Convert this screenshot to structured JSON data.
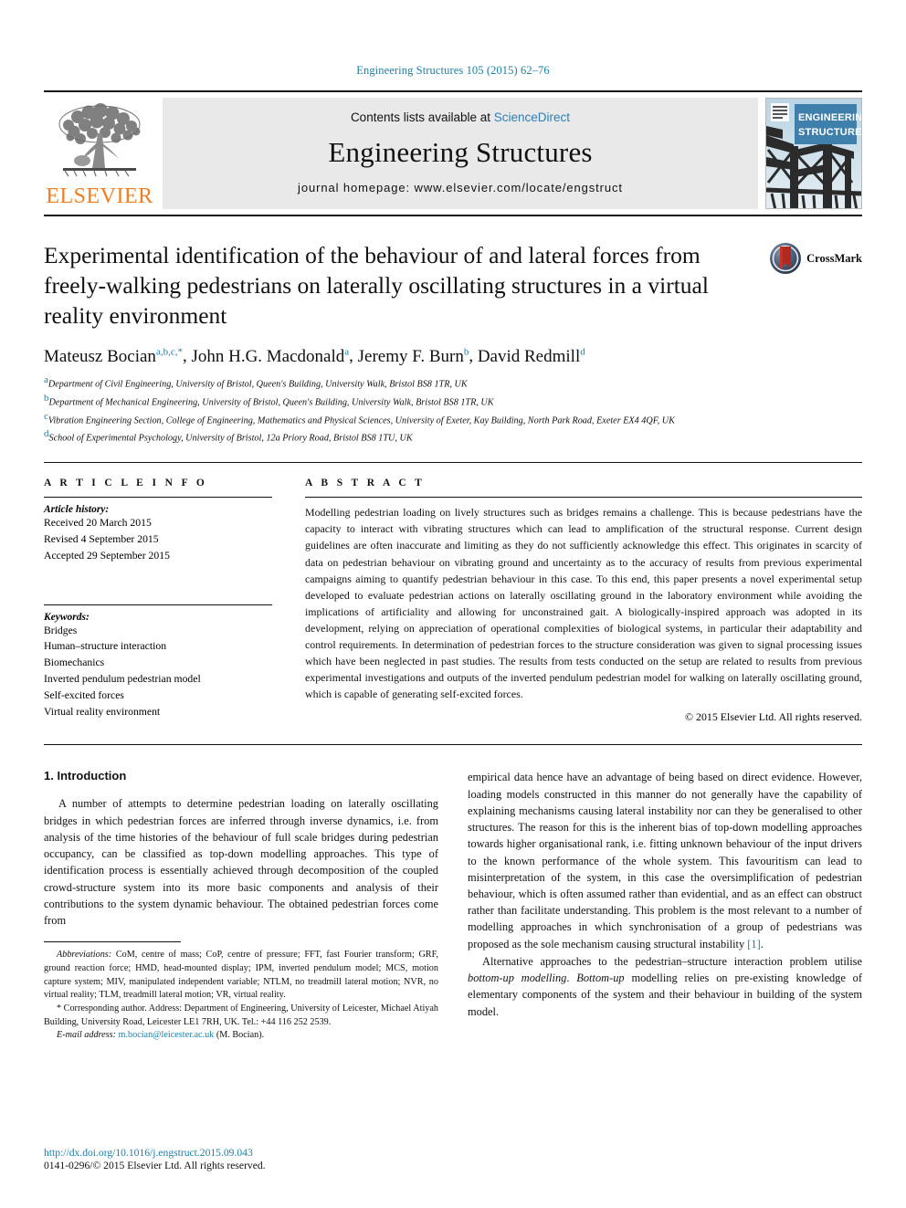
{
  "running_head": "Engineering Structures 105 (2015) 62–76",
  "masthead": {
    "publisher_wordmark": "ELSEVIER",
    "contents_prefix": "Contents lists available at ",
    "sciencedirect": "ScienceDirect",
    "journal_name": "Engineering Structures",
    "homepage": "journal homepage: www.elsevier.com/locate/engstruct",
    "cover_title_line1": "ENGINEERING",
    "cover_title_line2": "STRUCTURES"
  },
  "title": "Experimental identification of the behaviour of and lateral forces from freely-walking pedestrians on laterally oscillating structures in a virtual reality environment",
  "crossmark_label": "CrossMark",
  "authors": [
    {
      "name": "Mateusz Bocian",
      "marks": "a,b,c,*"
    },
    {
      "name": "John H.G. Macdonald",
      "marks": "a"
    },
    {
      "name": "Jeremy F. Burn",
      "marks": "b"
    },
    {
      "name": "David Redmill",
      "marks": "d"
    }
  ],
  "affiliations": [
    {
      "mark": "a",
      "text": "Department of Civil Engineering, University of Bristol, Queen's Building, University Walk, Bristol BS8 1TR, UK"
    },
    {
      "mark": "b",
      "text": "Department of Mechanical Engineering, University of Bristol, Queen's Building, University Walk, Bristol BS8 1TR, UK"
    },
    {
      "mark": "c",
      "text": "Vibration Engineering Section, College of Engineering, Mathematics and Physical Sciences, University of Exeter, Kay Building, North Park Road, Exeter EX4 4QF, UK"
    },
    {
      "mark": "d",
      "text": "School of Experimental Psychology, University of Bristol, 12a Priory Road, Bristol BS8 1TU, UK"
    }
  ],
  "article_info": {
    "heading": "A R T I C L E   I N F O",
    "history_label": "Article history:",
    "history": [
      "Received 20 March 2015",
      "Revised 4 September 2015",
      "Accepted 29 September 2015"
    ],
    "keywords_label": "Keywords:",
    "keywords": [
      "Bridges",
      "Human–structure interaction",
      "Biomechanics",
      "Inverted pendulum pedestrian model",
      "Self-excited forces",
      "Virtual reality environment"
    ]
  },
  "abstract": {
    "heading": "A B S T R A C T",
    "text": "Modelling pedestrian loading on lively structures such as bridges remains a challenge. This is because pedestrians have the capacity to interact with vibrating structures which can lead to amplification of the structural response. Current design guidelines are often inaccurate and limiting as they do not sufficiently acknowledge this effect. This originates in scarcity of data on pedestrian behaviour on vibrating ground and uncertainty as to the accuracy of results from previous experimental campaigns aiming to quantify pedestrian behaviour in this case. To this end, this paper presents a novel experimental setup developed to evaluate pedestrian actions on laterally oscillating ground in the laboratory environment while avoiding the implications of artificiality and allowing for unconstrained gait. A biologically-inspired approach was adopted in its development, relying on appreciation of operational complexities of biological systems, in particular their adaptability and control requirements. In determination of pedestrian forces to the structure consideration was given to signal processing issues which have been neglected in past studies. The results from tests conducted on the setup are related to results from previous experimental investigations and outputs of the inverted pendulum pedestrian model for walking on laterally oscillating ground, which is capable of generating self-excited forces.",
    "copyright": "© 2015 Elsevier Ltd. All rights reserved."
  },
  "body": {
    "section_title": "1. Introduction",
    "left_paragraphs": [
      "A number of attempts to determine pedestrian loading on laterally oscillating bridges in which pedestrian forces are inferred through inverse dynamics, i.e. from analysis of the time histories of the behaviour of full scale bridges during pedestrian occupancy, can be classified as top-down modelling approaches. This type of identification process is essentially achieved through decomposition of the coupled crowd-structure system into its more basic components and analysis of their contributions to the system dynamic behaviour. The obtained pedestrian forces come from"
    ],
    "right_paragraphs": [
      "empirical data hence have an advantage of being based on direct evidence. However, loading models constructed in this manner do not generally have the capability of explaining mechanisms causing lateral instability nor can they be generalised to other structures. The reason for this is the inherent bias of top-down modelling approaches towards higher organisational rank, i.e. fitting unknown behaviour of the input drivers to the known performance of the whole system. This favouritism can lead to misinterpretation of the system, in this case the oversimplification of pedestrian behaviour, which is often assumed rather than evidential, and as an effect can obstruct rather than facilitate understanding. This problem is the most relevant to a number of modelling approaches in which synchronisation of a group of pedestrians was proposed as the sole mechanism causing structural instability ",
      "Alternative approaches to the pedestrian–structure interaction problem utilise bottom-up modelling. Bottom-up modelling relies on pre-existing knowledge of elementary components of the system and their behaviour in building of the system model."
    ],
    "reference_marker": "[1]"
  },
  "footnotes": {
    "abbreviations_label": "Abbreviations:",
    "abbreviations_text": " CoM, centre of mass; CoP, centre of pressure; FFT, fast Fourier transform; GRF, ground reaction force; HMD, head-mounted display; IPM, inverted pendulum model; MCS, motion capture system; MIV, manipulated independent variable; NTLM, no treadmill lateral motion; NVR, no virtual reality; TLM, treadmill lateral motion; VR, virtual reality.",
    "corresponding": "* Corresponding author. Address: Department of Engineering, University of Leicester, Michael Atiyah Building, University Road, Leicester LE1 7RH, UK. Tel.: +44 116 252 2539.",
    "email_label": "E-mail address:",
    "email": "m.bocian@leicester.ac.uk",
    "email_suffix": " (M. Bocian)."
  },
  "footer": {
    "doi": "http://dx.doi.org/10.1016/j.engstruct.2015.09.043",
    "issn_line": "0141-0296/© 2015 Elsevier Ltd. All rights reserved."
  },
  "colors": {
    "link": "#1a7fa8",
    "elsevier_orange": "#ef7d22",
    "banner_gray": "#e9e9e9",
    "cover_blue": "#3f7fab"
  }
}
